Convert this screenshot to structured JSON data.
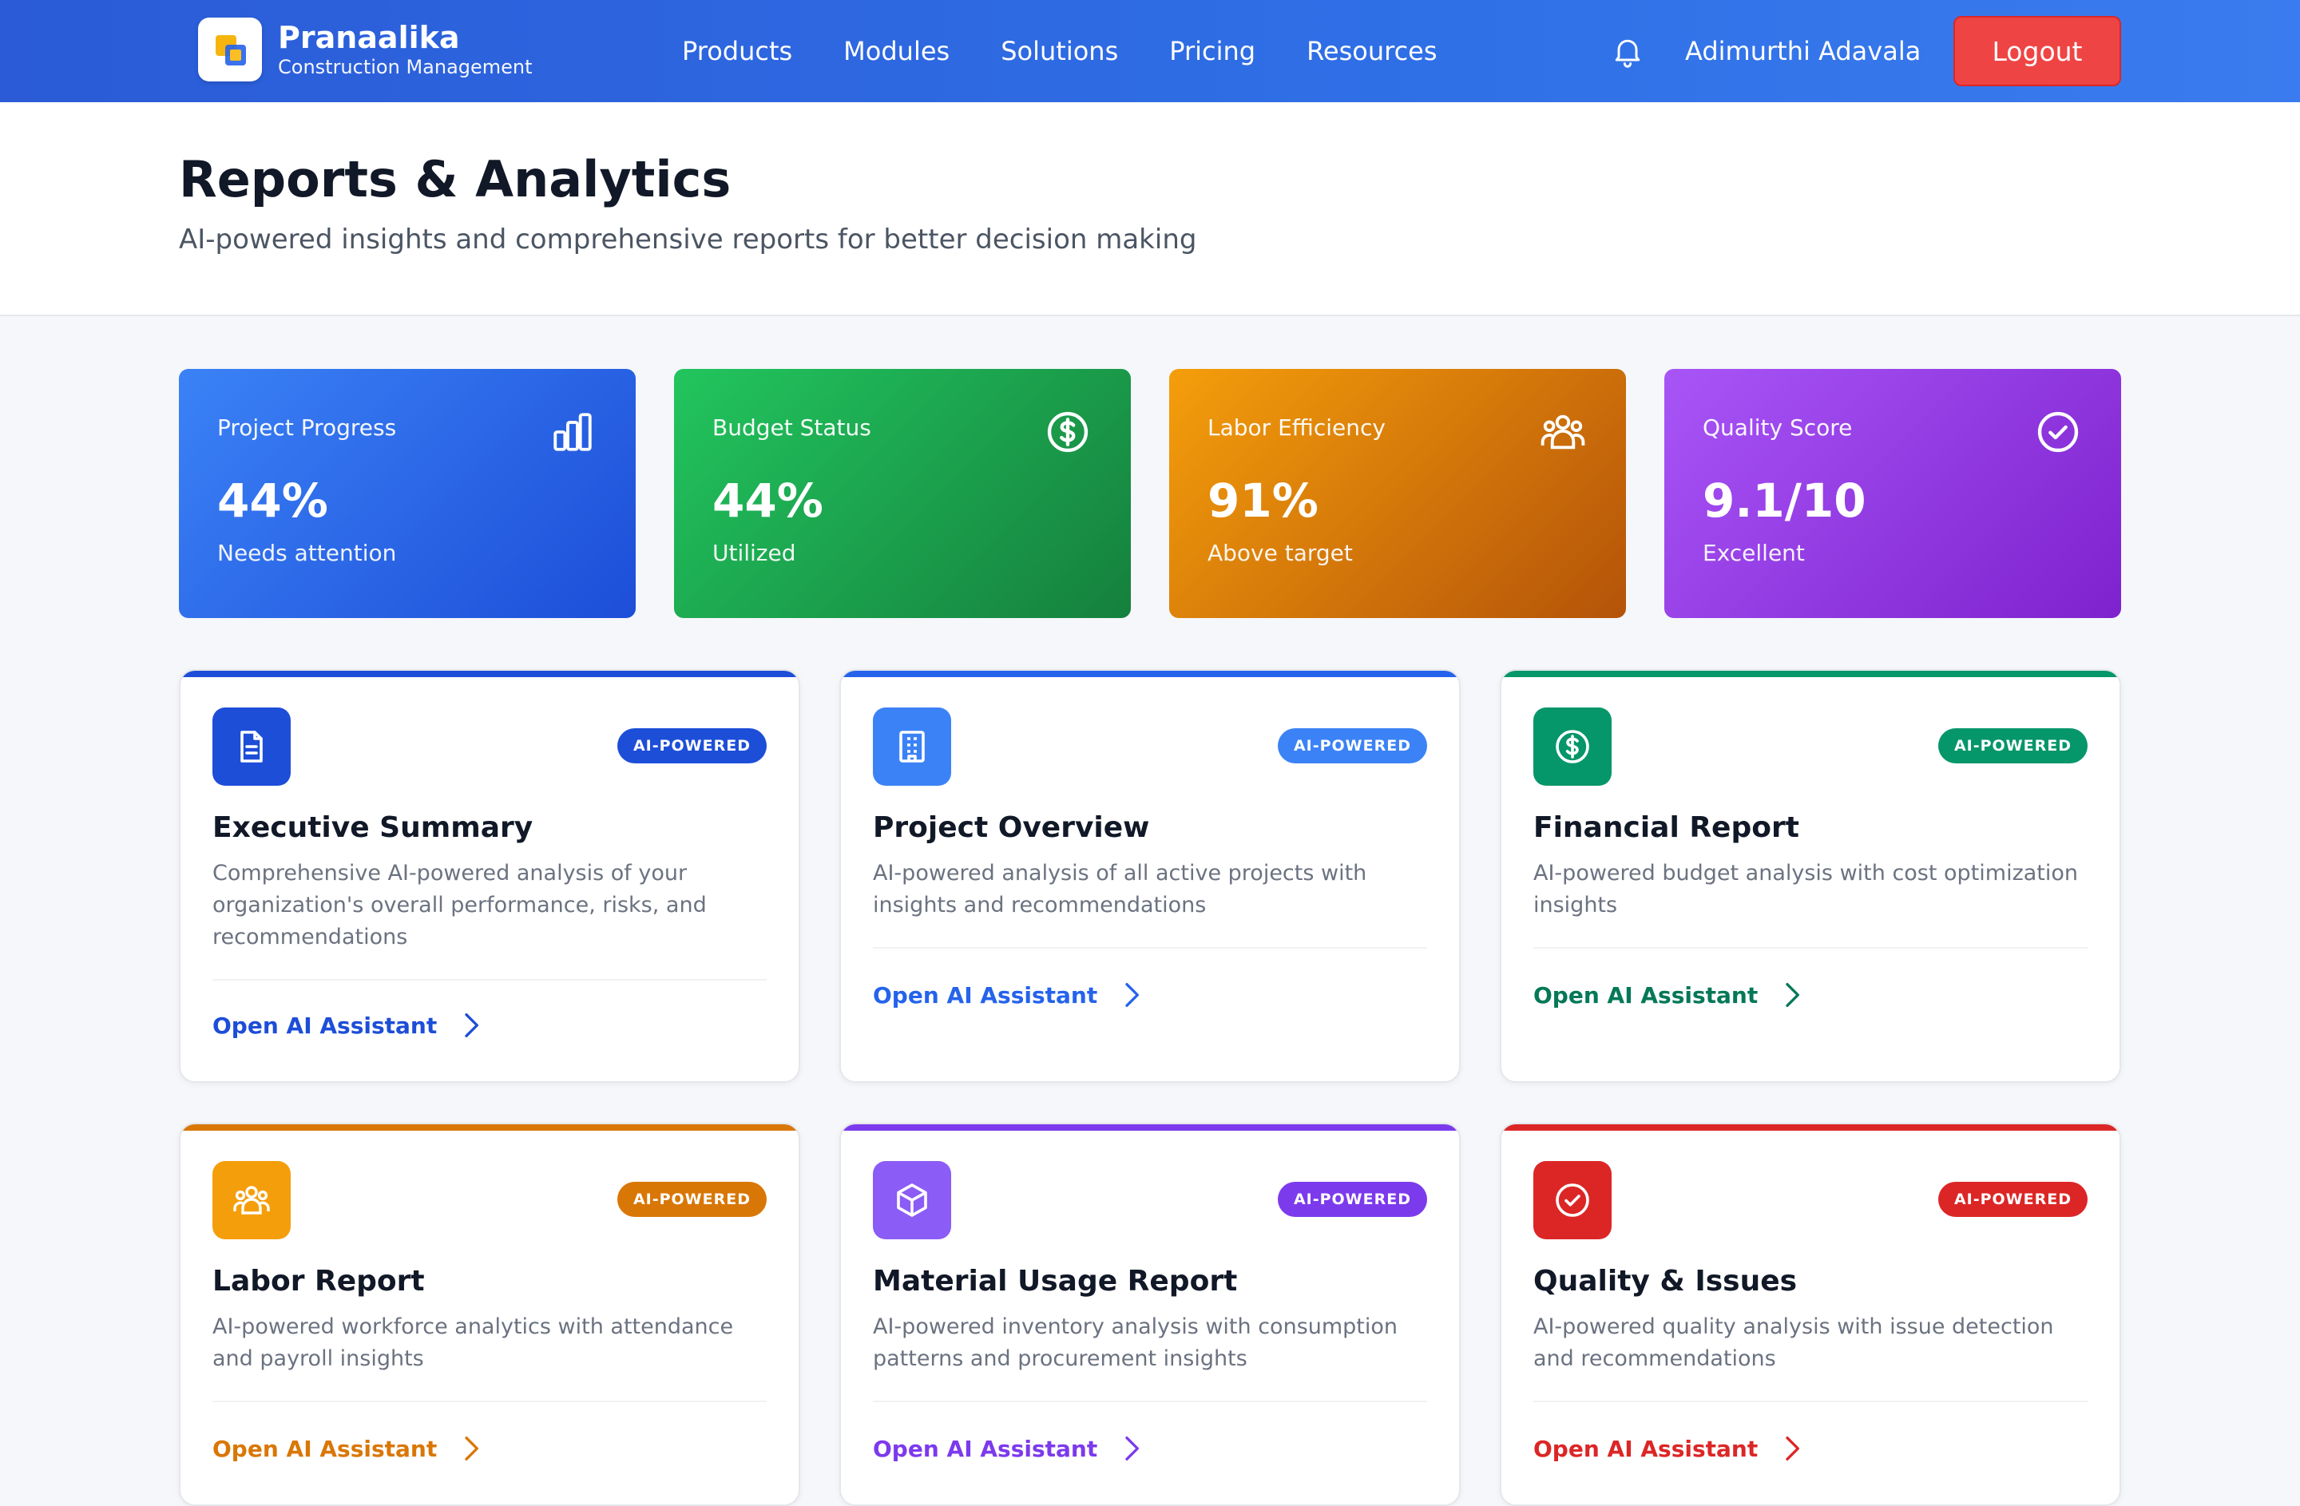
{
  "header": {
    "brand_name": "Pranaalika",
    "brand_sub": "Construction Management",
    "nav": [
      "Products",
      "Modules",
      "Solutions",
      "Pricing",
      "Resources"
    ],
    "username": "Adimurthi Adavala",
    "logout_label": "Logout"
  },
  "page": {
    "title": "Reports & Analytics",
    "subtitle": "AI-powered insights and comprehensive reports for better decision making"
  },
  "stats": [
    {
      "label": "Project Progress",
      "value": "44%",
      "note": "Needs attention",
      "icon": "bar-chart-icon"
    },
    {
      "label": "Budget Status",
      "value": "44%",
      "note": "Utilized",
      "icon": "dollar-circle-icon"
    },
    {
      "label": "Labor Efficiency",
      "value": "91%",
      "note": "Above target",
      "icon": "users-icon"
    },
    {
      "label": "Quality Score",
      "value": "9.1/10",
      "note": "Excellent",
      "icon": "check-circle-icon"
    }
  ],
  "reports": [
    {
      "title": "Executive Summary",
      "desc": "Comprehensive AI-powered analysis of your organization's overall performance, risks, and recommendations",
      "badge": "AI-POWERED",
      "link": "Open AI Assistant",
      "icon": "document-icon",
      "color": "#1d4ed8"
    },
    {
      "title": "Project Overview",
      "desc": "AI-powered analysis of all active projects with insights and recommendations",
      "badge": "AI-POWERED",
      "link": "Open AI Assistant",
      "icon": "building-icon",
      "color": "#3b82f6"
    },
    {
      "title": "Financial Report",
      "desc": "AI-powered budget analysis with cost optimization insights",
      "badge": "AI-POWERED",
      "link": "Open AI Assistant",
      "icon": "dollar-circle-icon",
      "color": "#059669"
    },
    {
      "title": "Labor Report",
      "desc": "AI-powered workforce analytics with attendance and payroll insights",
      "badge": "AI-POWERED",
      "link": "Open AI Assistant",
      "icon": "users-icon",
      "color": "#d97706"
    },
    {
      "title": "Material Usage Report",
      "desc": "AI-powered inventory analysis with consumption patterns and procurement insights",
      "badge": "AI-POWERED",
      "link": "Open AI Assistant",
      "icon": "box-icon",
      "color": "#7c3aed"
    },
    {
      "title": "Quality & Issues",
      "desc": "AI-powered quality analysis with issue detection and recommendations",
      "badge": "AI-POWERED",
      "link": "Open AI Assistant",
      "icon": "check-circle-icon",
      "color": "#dc2626"
    }
  ]
}
